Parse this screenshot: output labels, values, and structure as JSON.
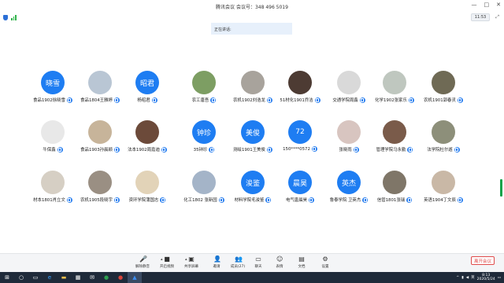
{
  "window": {
    "title": "腾讯会议  会议号：348 496 5019",
    "controls": [
      "—",
      "□",
      "✕"
    ]
  },
  "status": {
    "time_badge": "11:53",
    "clock_icon": "clock-icon"
  },
  "speaking": {
    "label": "正在讲话:"
  },
  "participants": [
    {
      "name": "食品1902徐晓雪",
      "avatar_text": "晓雪",
      "type": "text",
      "row": 0,
      "col": 0
    },
    {
      "name": "食品1804王雅婷",
      "avatar_text": "",
      "type": "img",
      "color": "#b9c6d4",
      "row": 0,
      "col": 1
    },
    {
      "name": "杨昭君",
      "avatar_text": "昭君",
      "type": "text",
      "row": 0,
      "col": 2
    },
    {
      "name": "农工唐吾",
      "avatar_text": "",
      "type": "img",
      "color": "#7d9e63",
      "row": 0,
      "col": 3
    },
    {
      "name": "农机1902刘浩龙",
      "avatar_text": "",
      "type": "img",
      "color": "#a8a39c",
      "row": 0,
      "col": 4
    },
    {
      "name": "51材化1901乔洁",
      "avatar_text": "",
      "type": "img",
      "color": "#4d3b33",
      "row": 0,
      "col": 5
    },
    {
      "name": "交通学院周鑫",
      "avatar_text": "",
      "type": "img",
      "color": "#d9d9d9",
      "row": 0,
      "col": 6
    },
    {
      "name": "化学1902张家乐",
      "avatar_text": "",
      "type": "img",
      "color": "#bfc7bf",
      "row": 0,
      "col": 7
    },
    {
      "name": "农机1901郭春灵",
      "avatar_text": "",
      "type": "img",
      "color": "#6f6a55",
      "row": 0,
      "col": 8
    },
    {
      "name": "牛保鑫",
      "avatar_text": "",
      "type": "img",
      "color": "#e8e8e8",
      "row": 1,
      "col": 0
    },
    {
      "name": "食品1903孙晨颖",
      "avatar_text": "",
      "type": "img",
      "color": "#c7b49a",
      "row": 1,
      "col": 1
    },
    {
      "name": "法本1902周嘉迪",
      "avatar_text": "",
      "type": "img",
      "color": "#6c4a3a",
      "row": 1,
      "col": 2
    },
    {
      "name": "35钟珍",
      "avatar_text": "钟珍",
      "type": "text",
      "row": 1,
      "col": 3
    },
    {
      "name": "测绘1901王美俊",
      "avatar_text": "美俊",
      "type": "text",
      "row": 1,
      "col": 4
    },
    {
      "name": "150****0572",
      "avatar_text": "72",
      "type": "text",
      "row": 1,
      "col": 5
    },
    {
      "name": "张晓雨",
      "avatar_text": "",
      "type": "img",
      "color": "#d8c5c0",
      "row": 1,
      "col": 6
    },
    {
      "name": "管理学院马永勤",
      "avatar_text": "",
      "type": "img",
      "color": "#7a5b4a",
      "row": 1,
      "col": 7
    },
    {
      "name": "法学院杜尔遊",
      "avatar_text": "",
      "type": "img",
      "color": "#8d8f7a",
      "row": 1,
      "col": 8
    },
    {
      "name": "材本1801肖立文",
      "avatar_text": "",
      "type": "img",
      "color": "#d6cfc4",
      "row": 2,
      "col": 0
    },
    {
      "name": "农机1905段晓宇",
      "avatar_text": "",
      "type": "img",
      "color": "#9a8f83",
      "row": 2,
      "col": 1
    },
    {
      "name": "资环学院蒲国志",
      "avatar_text": "",
      "type": "img",
      "color": "#e2d3b8",
      "row": 2,
      "col": 2
    },
    {
      "name": "化工1802 张新园",
      "avatar_text": "",
      "type": "img",
      "color": "#a4b4c8",
      "row": 2,
      "col": 3
    },
    {
      "name": "材料学院毛浚鉴",
      "avatar_text": "浚鉴",
      "type": "text",
      "row": 2,
      "col": 4
    },
    {
      "name": "电气唐晨昊",
      "avatar_text": "晨昊",
      "type": "text",
      "row": 2,
      "col": 5
    },
    {
      "name": "鲁泰学院 卫英杰",
      "avatar_text": "英杰",
      "type": "text",
      "row": 2,
      "col": 6
    },
    {
      "name": "信管1801张瑞",
      "avatar_text": "",
      "type": "img",
      "color": "#7f7668",
      "row": 2,
      "col": 7
    },
    {
      "name": "英语1904丁文辰",
      "avatar_text": "",
      "type": "img",
      "color": "#c9b8a6",
      "row": 2,
      "col": 8
    }
  ],
  "toolbar": {
    "items": [
      {
        "label": "解除静音",
        "icon": "mic-off-icon",
        "glyph": "🎤"
      },
      {
        "label": "开启视频",
        "icon": "camera-off-icon",
        "glyph": "■"
      },
      {
        "label": "共享屏幕",
        "icon": "share-screen-icon",
        "glyph": "▣"
      },
      {
        "label": "邀请",
        "icon": "invite-icon",
        "glyph": "👤"
      },
      {
        "label": "成员(27)",
        "icon": "members-icon",
        "glyph": "👥"
      },
      {
        "label": "聊天",
        "icon": "chat-icon",
        "glyph": "▭"
      },
      {
        "label": "表情",
        "icon": "emoji-icon",
        "glyph": "☺"
      },
      {
        "label": "文档",
        "icon": "document-icon",
        "glyph": "▤"
      },
      {
        "label": "设置",
        "icon": "settings-icon",
        "glyph": "⚙"
      }
    ],
    "leave_label": "离开会议"
  },
  "taskbar": {
    "time": "8:13",
    "date": "2020/5/24",
    "lang": "英"
  }
}
